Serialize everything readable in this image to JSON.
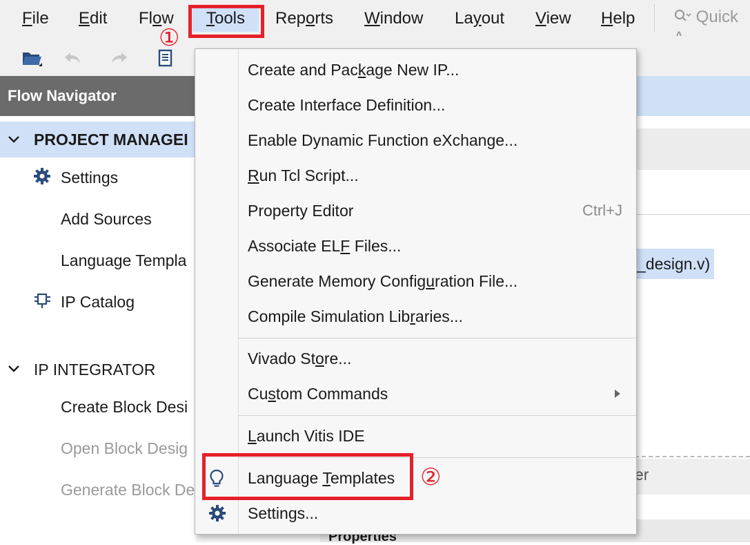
{
  "menubar": {
    "items": [
      {
        "pre": "",
        "ul": "F",
        "post": "ile"
      },
      {
        "pre": "",
        "ul": "E",
        "post": "dit"
      },
      {
        "pre": "Fl",
        "ul": "o",
        "post": "w"
      },
      {
        "pre": "",
        "ul": "T",
        "post": "ools"
      },
      {
        "pre": "Rep",
        "ul": "o",
        "post": "rts"
      },
      {
        "pre": "",
        "ul": "W",
        "post": "indow"
      },
      {
        "pre": "La",
        "ul": "y",
        "post": "out"
      },
      {
        "pre": "",
        "ul": "V",
        "post": "iew"
      },
      {
        "pre": "",
        "ul": "H",
        "post": "elp"
      }
    ],
    "quick_access_placeholder": "Quick A"
  },
  "toolbar": {
    "icons": [
      "open-project-icon",
      "undo-icon",
      "redo-icon",
      "report-icon"
    ]
  },
  "flow_navigator": {
    "title": "Flow Navigator",
    "project_manager": {
      "header": "PROJECT MANAGEI",
      "items": [
        "Settings",
        "Add Sources",
        "Language Templa",
        "IP Catalog"
      ]
    },
    "ip_integrator": {
      "header": "IP INTEGRATOR",
      "items": [
        "Create Block Desi",
        "Open Block Desig",
        "Generate Block De"
      ]
    }
  },
  "background": {
    "selected_file_fragment": "_design.v)",
    "tab_fragment": "er",
    "properties_label": "Properties"
  },
  "tools_menu": {
    "items": [
      {
        "pre": "Create and Pac",
        "ul": "k",
        "post": "age New IP...",
        "shortcut": ""
      },
      {
        "pre": "Create Interface Definition...",
        "ul": "",
        "post": "",
        "shortcut": ""
      },
      {
        "pre": "Enable Dynamic Function eXchange...",
        "ul": "",
        "post": "",
        "shortcut": ""
      },
      {
        "pre": "",
        "ul": "R",
        "post": "un Tcl Script...",
        "shortcut": ""
      },
      {
        "pre": "Property Editor",
        "ul": "",
        "post": "",
        "shortcut": "Ctrl+J"
      },
      {
        "pre": "Associate EL",
        "ul": "F",
        "post": " Files...",
        "shortcut": ""
      },
      {
        "pre": "Generate Memory Config",
        "ul": "u",
        "post": "ration File...",
        "shortcut": ""
      },
      {
        "pre": "Compile Simulation Lib",
        "ul": "r",
        "post": "aries...",
        "shortcut": ""
      },
      {
        "pre": "Vivado St",
        "ul": "o",
        "post": "re...",
        "shortcut": ""
      },
      {
        "pre": "Cu",
        "ul": "s",
        "post": "tom Commands",
        "shortcut": ""
      },
      {
        "pre": "",
        "ul": "L",
        "post": "aunch Vitis IDE",
        "shortcut": ""
      },
      {
        "pre": "Language ",
        "ul": "T",
        "post": "emplates",
        "shortcut": ""
      },
      {
        "pre": "Settings...",
        "ul": "",
        "post": "",
        "shortcut": ""
      }
    ]
  },
  "annotations": {
    "step1": "①",
    "step2": "②",
    "highlight_color": "#e5202a"
  },
  "colors": {
    "selection_blue": "#cfe0f7",
    "icon_blue": "#2a4a7a",
    "nav_header_gray": "#6b6b6b"
  }
}
